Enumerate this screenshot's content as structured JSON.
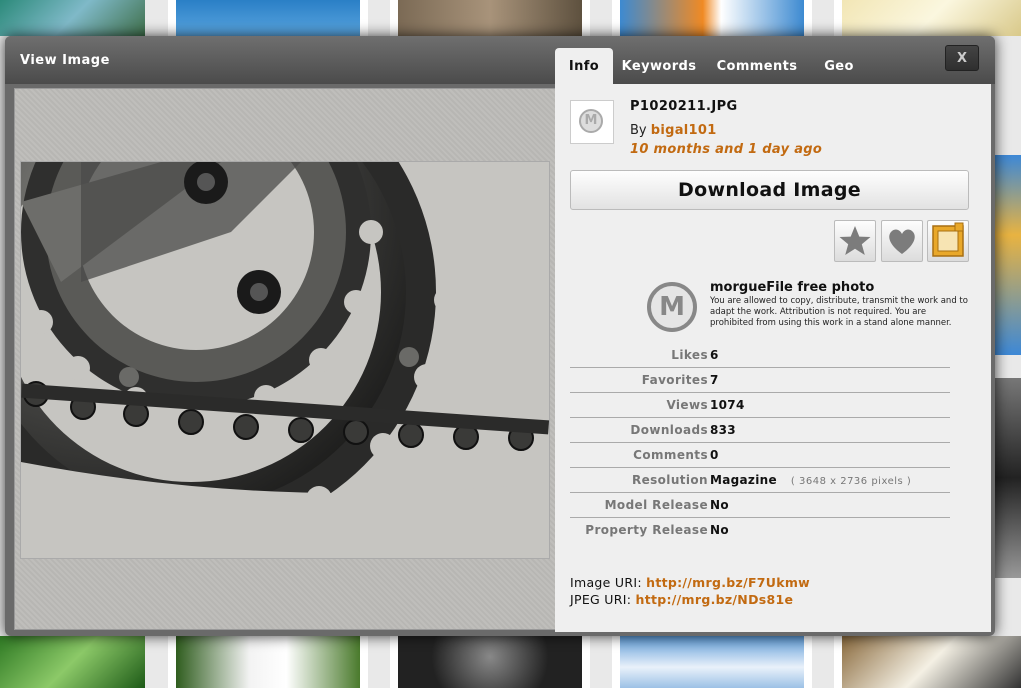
{
  "modal": {
    "title": "View Image",
    "close_label": "X",
    "tabs": [
      "Info",
      "Keywords",
      "Comments",
      "Geo"
    ],
    "active_tab": "Info"
  },
  "image": {
    "filename": "P1020211.JPG",
    "by_prefix": "By",
    "author": "bigal101",
    "age": "10 months and 1 day ago"
  },
  "actions": {
    "download_label": "Download Image",
    "favorite_icon": "star-icon",
    "like_icon": "heart-icon",
    "lightbox_icon": "lightbox-icon"
  },
  "license": {
    "logo": "M",
    "title": "morgueFile free photo",
    "text": "You are allowed to copy, distribute, transmit the work and to adapt the work. Attribution is not required. You are prohibited from using this work in a stand alone manner."
  },
  "stats": [
    {
      "label": "Likes",
      "value": "6",
      "extra": ""
    },
    {
      "label": "Favorites",
      "value": "7",
      "extra": ""
    },
    {
      "label": "Views",
      "value": "1074",
      "extra": ""
    },
    {
      "label": "Downloads",
      "value": "833",
      "extra": ""
    },
    {
      "label": "Comments",
      "value": "0",
      "extra": ""
    },
    {
      "label": "Resolution",
      "value": "Magazine",
      "extra": "( 3648 x 2736 pixels )"
    },
    {
      "label": "Model Release",
      "value": "No",
      "extra": ""
    },
    {
      "label": "Property Release",
      "value": "No",
      "extra": ""
    }
  ],
  "uris": {
    "image_label": "Image URI:",
    "image_url": "http://mrg.bz/F7Ukmw",
    "jpeg_label": "JPEG URI:",
    "jpeg_url": "http://mrg.bz/NDs81e"
  },
  "colors": {
    "accent": "#c26a11",
    "modal_bar": "#4b4b4b",
    "panel_bg": "#efefef"
  }
}
